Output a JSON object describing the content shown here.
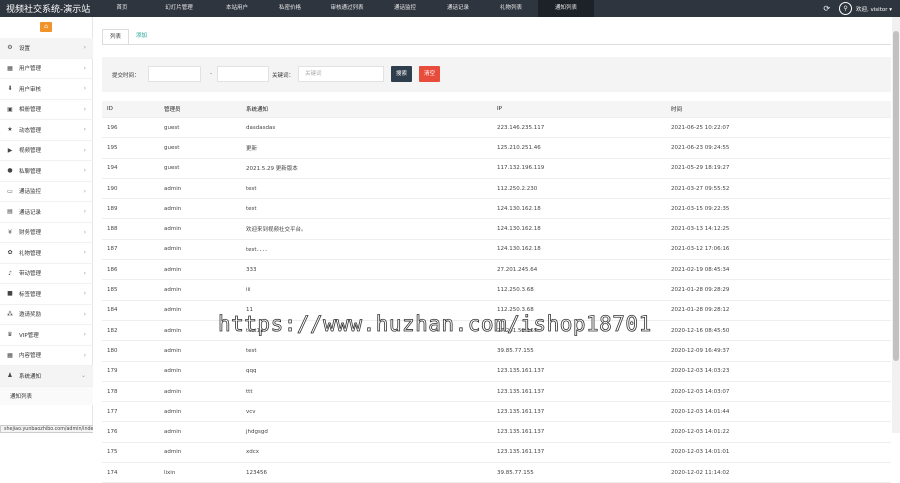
{
  "header": {
    "brand": "视频社交系统-演示站",
    "nav": [
      {
        "label": "首页",
        "w": 52
      },
      {
        "label": "幻灯片管理",
        "w": 62
      },
      {
        "label": "本站用户",
        "w": 54
      },
      {
        "label": "私密价格",
        "w": 52
      },
      {
        "label": "审核通过列表",
        "w": 62
      },
      {
        "label": "通话监控",
        "w": 54
      },
      {
        "label": "通话记录",
        "w": 52
      },
      {
        "label": "礼物列表",
        "w": 54
      },
      {
        "label": "通知列表",
        "w": 56
      }
    ],
    "user": "欢迎, visitor ▾"
  },
  "sidebar": {
    "items": [
      {
        "label": "设置",
        "icon": "⚙"
      },
      {
        "label": "用户管理",
        "icon": "▦"
      },
      {
        "label": "用户审核",
        "icon": "⬇"
      },
      {
        "label": "相册管理",
        "icon": "▣"
      },
      {
        "label": "动态管理",
        "icon": "★"
      },
      {
        "label": "视频管理",
        "icon": "▶"
      },
      {
        "label": "私聊管理",
        "icon": "●"
      },
      {
        "label": "通话监控",
        "icon": "▭"
      },
      {
        "label": "通话记录",
        "icon": "▤"
      },
      {
        "label": "财务管理",
        "icon": "¥"
      },
      {
        "label": "礼物管理",
        "icon": "✿"
      },
      {
        "label": "带动管理",
        "icon": "♪"
      },
      {
        "label": "标签管理",
        "icon": "■"
      },
      {
        "label": "邀请奖励",
        "icon": "⁂"
      },
      {
        "label": "VIP管理",
        "icon": "♛"
      },
      {
        "label": "内容管理",
        "icon": "▦"
      },
      {
        "label": "系统通知",
        "icon": "♟"
      }
    ],
    "sub_item": "通知列表",
    "status_url": "shejiao.yunbaozhibo.com/admin/index/index.html#"
  },
  "main": {
    "tabs": [
      "列表",
      "添加"
    ],
    "filter": {
      "time_label": "提交时间：",
      "dash": "-",
      "keyword_label": "关键词：",
      "keyword_placeholder": "关键词",
      "search_btn": "搜索",
      "clear_btn": "清空"
    },
    "table": {
      "columns": [
        "ID",
        "管理员",
        "系统通知",
        "IP",
        "时间"
      ],
      "rows": [
        [
          "196",
          "guest",
          "dasdasdas",
          "223.146.235.117",
          "2021-06-25 10:22:07"
        ],
        [
          "195",
          "guest",
          "更新",
          "125.210.251.46",
          "2021-06-23 09:24:55"
        ],
        [
          "194",
          "guest",
          "2021.5.29 更新版本",
          "117.132.196.119",
          "2021-05-29 18:19:27"
        ],
        [
          "190",
          "admin",
          "test",
          "112.250.2.230",
          "2021-03-27 09:55:52"
        ],
        [
          "189",
          "admin",
          "test",
          "124.130.162.18",
          "2021-03-15 09:22:35"
        ],
        [
          "188",
          "admin",
          "欢迎来到视频社交平台。",
          "124.130.162.18",
          "2021-03-13 14:12:25"
        ],
        [
          "187",
          "admin",
          "test．．．．",
          "124.130.162.18",
          "2021-03-12 17:06:16"
        ],
        [
          "186",
          "admin",
          "333",
          "27.201.245.64",
          "2021-02-19 08:45:34"
        ],
        [
          "185",
          "admin",
          "iii",
          "112.250.3.68",
          "2021-01-28 09:28:29"
        ],
        [
          "184",
          "admin",
          "11",
          "112.250.3.68",
          "2021-01-28 09:28:12"
        ],
        [
          "182",
          "admin",
          "test11",
          "27.201.59.169",
          "2020-12-16 08:45:50"
        ],
        [
          "180",
          "admin",
          "test",
          "39.85.77.155",
          "2020-12-09 16:49:37"
        ],
        [
          "179",
          "admin",
          "qqq",
          "123.135.161.137",
          "2020-12-03 14:03:23"
        ],
        [
          "178",
          "admin",
          "ttt",
          "123.135.161.137",
          "2020-12-03 14:03:07"
        ],
        [
          "177",
          "admin",
          "vcv",
          "123.135.161.137",
          "2020-12-03 14:01:44"
        ],
        [
          "176",
          "admin",
          "jhdgsgd",
          "123.135.161.137",
          "2020-12-03 14:01:22"
        ],
        [
          "175",
          "admin",
          "xdcx",
          "123.135.161.137",
          "2020-12-03 14:01:01"
        ],
        [
          "174",
          "lixin",
          "123456",
          "39.85.77.155",
          "2020-12-02 11:14:02"
        ]
      ]
    }
  },
  "watermark": "https://www.huzhan.com/ishop18701"
}
